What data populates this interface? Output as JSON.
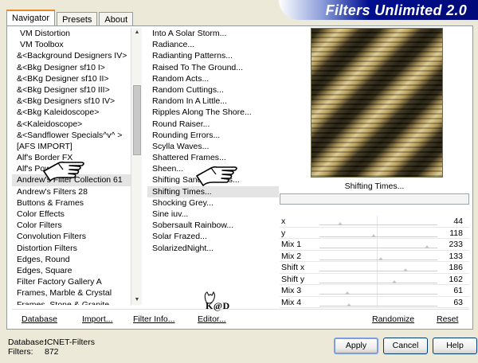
{
  "tabs": [
    {
      "label": "Navigator",
      "active": true
    },
    {
      "label": "Presets",
      "active": false
    },
    {
      "label": "About",
      "active": false
    }
  ],
  "banner": {
    "title": "Filters Unlimited 2.0"
  },
  "categories": [
    {
      "label": "VM Distortion",
      "indent": true
    },
    {
      "label": "VM Toolbox",
      "indent": true
    },
    {
      "label": "&<Background Designers IV>"
    },
    {
      "label": "&<Bkg Designer sf10 I>"
    },
    {
      "label": "&<BKg Designer sf10 II>"
    },
    {
      "label": "&<Bkg Designer sf10 III>"
    },
    {
      "label": "&<Bkg Designers sf10 IV>"
    },
    {
      "label": "&<Bkg Kaleidoscope>"
    },
    {
      "label": "&<Kaleidoscope>"
    },
    {
      "label": "&<Sandflower Specials^v^ >"
    },
    {
      "label": "[AFS IMPORT]"
    },
    {
      "label": "Alf's Border FX"
    },
    {
      "label": "Alf's Power"
    },
    {
      "label": "Andrew's Filter Collection 61",
      "selected": true
    },
    {
      "label": "Andrew's Filters 28"
    },
    {
      "label": "Buttons & Frames"
    },
    {
      "label": "Color Effects"
    },
    {
      "label": "Color Filters"
    },
    {
      "label": "Convolution Filters"
    },
    {
      "label": "Distortion Filters"
    },
    {
      "label": "Edges, Round"
    },
    {
      "label": "Edges, Square"
    },
    {
      "label": "Filter Factory Gallery A"
    },
    {
      "label": "Frames, Marble & Crystal"
    },
    {
      "label": "Frames, Stone & Granite"
    },
    {
      "label": "Frames, ..."
    }
  ],
  "filters": [
    {
      "label": "Into A Solar Storm..."
    },
    {
      "label": "Radiance..."
    },
    {
      "label": "Radianting Patterns..."
    },
    {
      "label": "Raised To The Ground..."
    },
    {
      "label": "Random Acts..."
    },
    {
      "label": "Random Cuttings..."
    },
    {
      "label": "Random In A Little..."
    },
    {
      "label": "Ripples Along The Shore..."
    },
    {
      "label": "Round Raiser..."
    },
    {
      "label": "Rounding Errors..."
    },
    {
      "label": "Scylla Waves..."
    },
    {
      "label": "Shattered Frames..."
    },
    {
      "label": "Sheen..."
    },
    {
      "label": "Shifting Sand Frames..."
    },
    {
      "label": "Shifting Times...",
      "selected": true
    },
    {
      "label": "Shocking Grey..."
    },
    {
      "label": "Sine iuv..."
    },
    {
      "label": "Sobersault Rainbow..."
    },
    {
      "label": "Solar Frazed..."
    },
    {
      "label": "SolarizedNight..."
    }
  ],
  "selected_filter": "Shifting Times...",
  "sliders": [
    {
      "label": "x",
      "value": 44
    },
    {
      "label": "y",
      "value": 118
    },
    {
      "label": "Mix 1",
      "value": 233
    },
    {
      "label": "Mix 2",
      "value": 133
    },
    {
      "label": "Shift x",
      "value": 186
    },
    {
      "label": "Shift y",
      "value": 162
    },
    {
      "label": "Mix 3",
      "value": 61
    },
    {
      "label": "Mix 4",
      "value": 63
    }
  ],
  "bottom_links": {
    "database": "Database",
    "import": "Import...",
    "filter_info": "Filter Info...",
    "editor": "Editor...",
    "randomize": "Randomize",
    "reset": "Reset"
  },
  "db_info": {
    "database_label": "Database:",
    "database_value": "ICNET-Filters",
    "filters_label": "Filters:",
    "filters_value": "872"
  },
  "buttons": {
    "apply": "Apply",
    "cancel": "Cancel",
    "help": "Help"
  },
  "logo_text": "K@D",
  "icons": {
    "hand": "pointing-hand-icon",
    "scroll_up": "arrow-up-icon",
    "scroll_down": "arrow-down-icon"
  },
  "colors": {
    "banner": "#000a78",
    "tab_highlight": "#e68b2c",
    "apply_focus": "#7b9ee3"
  }
}
